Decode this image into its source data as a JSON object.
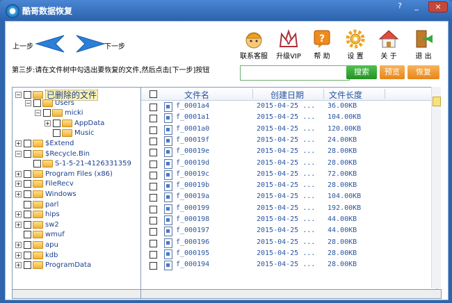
{
  "window": {
    "title": "酷哥数据恢复",
    "controls": [
      "?",
      "_",
      "×"
    ]
  },
  "nav": {
    "prev_label": "上一步",
    "next_label": "下一步"
  },
  "step_text": "第三步:请在文件树中勾选出要恢复的文件,然后点击[下一步]按钮",
  "toolbar": [
    {
      "label": "联系客服",
      "icon": "support-person-icon"
    },
    {
      "label": "升级VIP",
      "icon": "vip-crown-icon"
    },
    {
      "label": "帮 助",
      "icon": "help-icon"
    },
    {
      "label": "设 置",
      "icon": "gear-icon"
    },
    {
      "label": "关 于",
      "icon": "home-icon"
    },
    {
      "label": "退 出",
      "icon": "exit-door-icon"
    }
  ],
  "search": {
    "value": "",
    "button": "搜索"
  },
  "actions": {
    "preview": "预览",
    "recover": "恢复"
  },
  "tree": [
    {
      "label": "已删除的文件",
      "depth": 0,
      "expander": "−",
      "highlight": true
    },
    {
      "label": "Users",
      "depth": 1,
      "expander": "−"
    },
    {
      "label": "micki",
      "depth": 2,
      "expander": "−"
    },
    {
      "label": "AppData",
      "depth": 3,
      "expander": "+"
    },
    {
      "label": "Music",
      "depth": 3,
      "expander": ""
    },
    {
      "label": "$Extend",
      "depth": 0,
      "expander": "+"
    },
    {
      "label": "$Recycle.Bin",
      "depth": 0,
      "expander": "−"
    },
    {
      "label": "S-1-5-21-4126331359",
      "depth": 1,
      "expander": ""
    },
    {
      "label": "Program Files (x86)",
      "depth": 0,
      "expander": "+"
    },
    {
      "label": "FileRecv",
      "depth": 0,
      "expander": "+"
    },
    {
      "label": "Windows",
      "depth": 0,
      "expander": "+"
    },
    {
      "label": "parl",
      "depth": 0,
      "expander": ""
    },
    {
      "label": "hips",
      "depth": 0,
      "expander": "+"
    },
    {
      "label": "sw2",
      "depth": 0,
      "expander": "+"
    },
    {
      "label": "wmuf",
      "depth": 0,
      "expander": ""
    },
    {
      "label": "apu",
      "depth": 0,
      "expander": "+"
    },
    {
      "label": "kdb",
      "depth": 0,
      "expander": "+"
    },
    {
      "label": "ProgramData",
      "depth": 0,
      "expander": "+"
    }
  ],
  "list": {
    "columns": [
      "文件名",
      "创建日期",
      "文件长度"
    ],
    "rows": [
      [
        "f_0001a4",
        "2015-04-25 ...",
        "36.00KB"
      ],
      [
        "f_0001a1",
        "2015-04-25 ...",
        "104.00KB"
      ],
      [
        "f_0001a0",
        "2015-04-25 ...",
        "120.00KB"
      ],
      [
        "f_00019f",
        "2015-04-25 ...",
        "24.00KB"
      ],
      [
        "f_00019e",
        "2015-04-25 ...",
        "28.00KB"
      ],
      [
        "f_00019d",
        "2015-04-25 ...",
        "28.00KB"
      ],
      [
        "f_00019c",
        "2015-04-25 ...",
        "72.00KB"
      ],
      [
        "f_00019b",
        "2015-04-25 ...",
        "28.00KB"
      ],
      [
        "f_00019a",
        "2015-04-25 ...",
        "104.00KB"
      ],
      [
        "f_000199",
        "2015-04-25 ...",
        "192.00KB"
      ],
      [
        "f_000198",
        "2015-04-25 ...",
        "44.00KB"
      ],
      [
        "f_000197",
        "2015-04-25 ...",
        "44.00KB"
      ],
      [
        "f_000196",
        "2015-04-25 ...",
        "28.00KB"
      ],
      [
        "f_000195",
        "2015-04-25 ...",
        "28.00KB"
      ],
      [
        "f_000194",
        "2015-04-25 ...",
        "28.00KB"
      ]
    ]
  },
  "colors": {
    "accent": "#2f65ad",
    "search_green": "#259125",
    "action_orange": "#e6861a",
    "text_blue": "#2a55a0"
  }
}
